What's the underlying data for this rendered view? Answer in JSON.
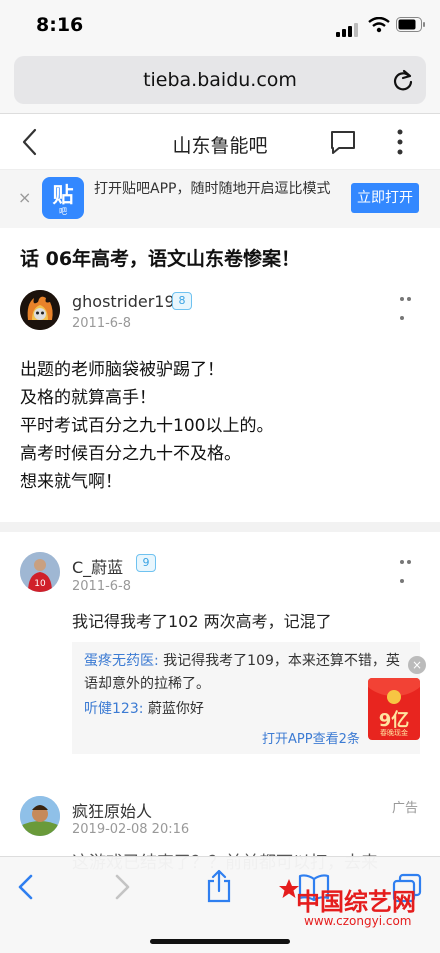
{
  "status": {
    "time": "8:16"
  },
  "browser": {
    "url": "tieba.baidu.com"
  },
  "header": {
    "title": "山东鲁能吧"
  },
  "banner": {
    "logo_char": "贴",
    "logo_sub": "吧",
    "text": "打开贴吧APP，随时随地开启逗比模式",
    "open_label": "立即打开",
    "close": "×"
  },
  "thread": {
    "title": "话 06年高考，语文山东卷惨案！"
  },
  "op": {
    "username": "ghostrider19",
    "level": "8",
    "date": "2011-6-8",
    "lines": [
      "出题的老师脑袋被驴踢了！",
      "及格的就算高手！",
      "平时考试百分之九十100以上的。",
      "高考时候百分之九十不及格。",
      "想来就气啊！"
    ]
  },
  "reply1": {
    "username": "C_蔚蓝",
    "level": "9",
    "date": "2011-6-8",
    "text": "我记得我考了102 两次高考，记混了",
    "subs": [
      {
        "name": "蛋疼无药医:",
        "text": " 我记得我考了109，本来还算不错，英语却意外的拉稀了。"
      },
      {
        "name": "听健123:",
        "text": " 蔚蓝你好"
      }
    ],
    "open_more": "打开APP查看2条"
  },
  "red_packet": {
    "amount": "9亿",
    "sub": "春晚现金"
  },
  "ad": {
    "username": "疯狂原始人",
    "date": "2019-02-08 20:16",
    "tag": "广告",
    "text": "这游戏已结束了？？前前都可以打，去来"
  },
  "watermark": {
    "title": "中国综艺网",
    "url": "www.czongyi.com"
  }
}
